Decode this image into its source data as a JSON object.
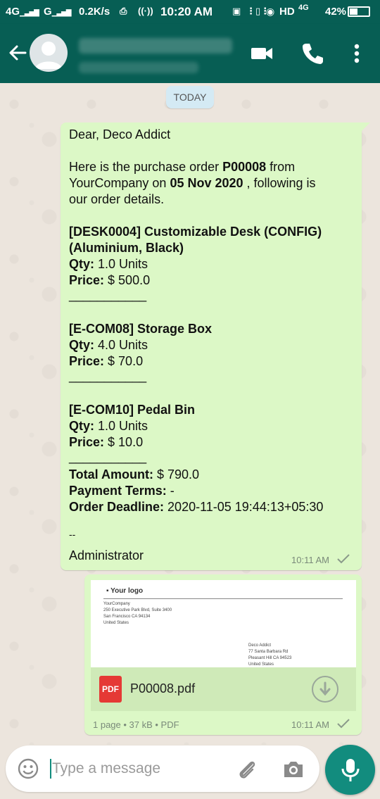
{
  "status_bar": {
    "network_1": "4G",
    "network_2": "G",
    "speed": "0.2K/s",
    "time": "10:20 AM",
    "hd_label": "HD",
    "network_3": "4G",
    "battery": "42%",
    "battery_level": 0.42
  },
  "header": {
    "colors": {
      "bar": "#075e54",
      "accent": "#128c7e"
    }
  },
  "chat": {
    "date_chip": "TODAY",
    "message": {
      "greeting": "Dear, Deco Addict",
      "intro": {
        "p1": "Here is the purchase order ",
        "po": "P00008",
        "p2": " from",
        "p3": "YourCompany on ",
        "date": "05 Nov 2020",
        "p4": " , following is",
        "p5": "our order details."
      },
      "items": [
        {
          "title_1": "[DESK0004] Customizable Desk (CONFIG)",
          "title_2": "(Aluminium, Black)",
          "qty_label": "Qty:",
          "qty": " 1.0 Units",
          "price_label": "Price:",
          "price": " $ 500.0",
          "separator": "___________"
        },
        {
          "title_1": "[E-COM08] Storage Box",
          "qty_label": "Qty:",
          "qty": " 4.0 Units",
          "price_label": "Price:",
          "price": " $ 70.0",
          "separator": "___________"
        },
        {
          "title_1": "[E-COM10] Pedal Bin",
          "qty_label": "Qty:",
          "qty": " 1.0 Units",
          "price_label": "Price:",
          "price": " $ 10.0",
          "separator": "___________"
        }
      ],
      "total_label": "Total Amount:",
      "total": " $ 790.0",
      "terms_label": "Payment Terms:",
      "terms": " -",
      "deadline_label": "Order Deadline:",
      "deadline": " 2020-11-05 19:44:13+05:30",
      "sig_sep": "--",
      "signature": "Administrator",
      "time": "10:11 AM"
    },
    "attachment": {
      "preview": {
        "logo": "Your logo",
        "company": "YourCompany",
        "addr1": "250 Executive Park Blvd, Suite 3400",
        "addr2": "San Francisco CA 94134",
        "country": "United States",
        "to_name": "Deco Addict",
        "to_addr1": "77 Santa Barbara Rd",
        "to_addr2": "Pleasant Hill CA 94523",
        "to_country": "United States"
      },
      "icon_label": "PDF",
      "filename": "P00008.pdf",
      "info": "1 page • 37 kB • PDF",
      "time": "10:11 AM"
    }
  },
  "composer": {
    "placeholder": "Type a message"
  }
}
